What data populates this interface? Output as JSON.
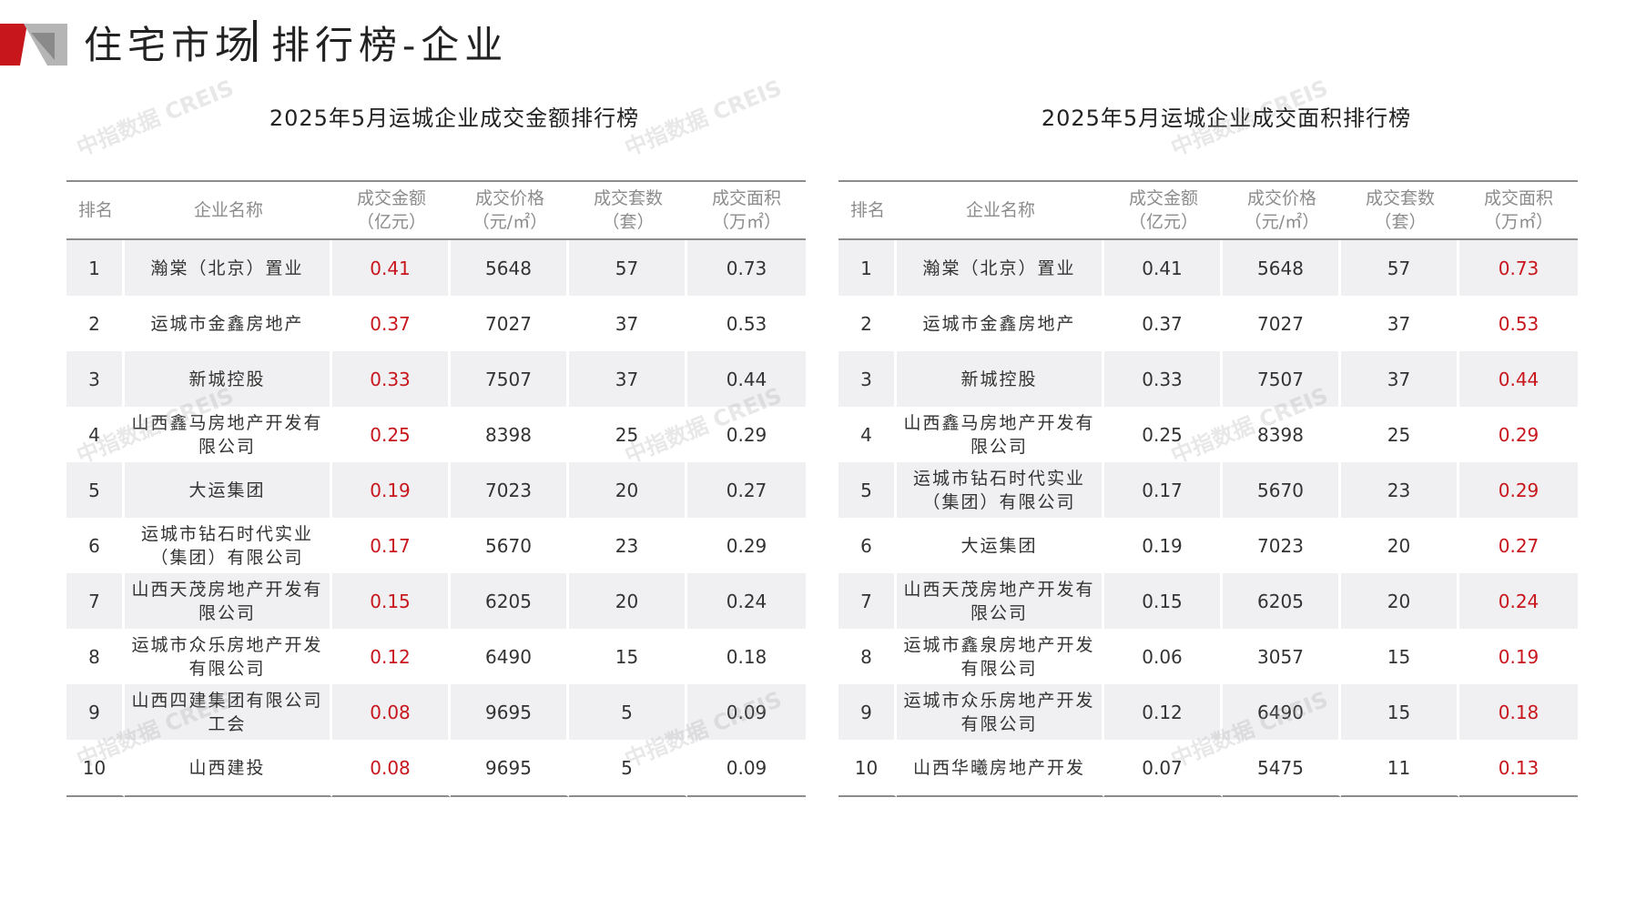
{
  "header": {
    "title_main": "住宅市场",
    "title_sub": "排行榜-企业"
  },
  "colors": {
    "accent": "#c8161d",
    "header_text": "#8c8c8c",
    "row_shade": "#f0f0f2"
  },
  "watermark": "中指数据 CREIS",
  "left_table": {
    "title": "2025年5月运城企业成交金额排行榜",
    "columns": [
      "排名",
      "企业名称",
      "成交金额\n（亿元）",
      "成交价格\n（元/㎡）",
      "成交套数\n（套）",
      "成交面积\n（万㎡）"
    ],
    "rows": [
      [
        "1",
        "瀚棠（北京）置业",
        "0.41",
        "5648",
        "57",
        "0.73"
      ],
      [
        "2",
        "运城市金鑫房地产",
        "0.37",
        "7027",
        "37",
        "0.53"
      ],
      [
        "3",
        "新城控股",
        "0.33",
        "7507",
        "37",
        "0.44"
      ],
      [
        "4",
        "山西鑫马房地产开发有\n限公司",
        "0.25",
        "8398",
        "25",
        "0.29"
      ],
      [
        "5",
        "大运集团",
        "0.19",
        "7023",
        "20",
        "0.27"
      ],
      [
        "6",
        "运城市钻石时代实业\n（集团）有限公司",
        "0.17",
        "5670",
        "23",
        "0.29"
      ],
      [
        "7",
        "山西天茂房地产开发有\n限公司",
        "0.15",
        "6205",
        "20",
        "0.24"
      ],
      [
        "8",
        "运城市众乐房地产开发\n有限公司",
        "0.12",
        "6490",
        "15",
        "0.18"
      ],
      [
        "9",
        "山西四建集团有限公司\n工会",
        "0.08",
        "9695",
        "5",
        "0.09"
      ],
      [
        "10",
        "山西建投",
        "0.08",
        "9695",
        "5",
        "0.09"
      ]
    ]
  },
  "right_table": {
    "title": "2025年5月运城企业成交面积排行榜",
    "columns": [
      "排名",
      "企业名称",
      "成交金额\n（亿元）",
      "成交价格\n（元/㎡）",
      "成交套数\n（套）",
      "成交面积\n（万㎡）"
    ],
    "rows": [
      [
        "1",
        "瀚棠（北京）置业",
        "0.41",
        "5648",
        "57",
        "0.73"
      ],
      [
        "2",
        "运城市金鑫房地产",
        "0.37",
        "7027",
        "37",
        "0.53"
      ],
      [
        "3",
        "新城控股",
        "0.33",
        "7507",
        "37",
        "0.44"
      ],
      [
        "4",
        "山西鑫马房地产开发有\n限公司",
        "0.25",
        "8398",
        "25",
        "0.29"
      ],
      [
        "5",
        "运城市钻石时代实业\n（集团）有限公司",
        "0.17",
        "5670",
        "23",
        "0.29"
      ],
      [
        "6",
        "大运集团",
        "0.19",
        "7023",
        "20",
        "0.27"
      ],
      [
        "7",
        "山西天茂房地产开发有\n限公司",
        "0.15",
        "6205",
        "20",
        "0.24"
      ],
      [
        "8",
        "运城市鑫泉房地产开发\n有限公司",
        "0.06",
        "3057",
        "15",
        "0.19"
      ],
      [
        "9",
        "运城市众乐房地产开发\n有限公司",
        "0.12",
        "6490",
        "15",
        "0.18"
      ],
      [
        "10",
        "山西华曦房地产开发",
        "0.07",
        "5475",
        "11",
        "0.13"
      ]
    ]
  }
}
